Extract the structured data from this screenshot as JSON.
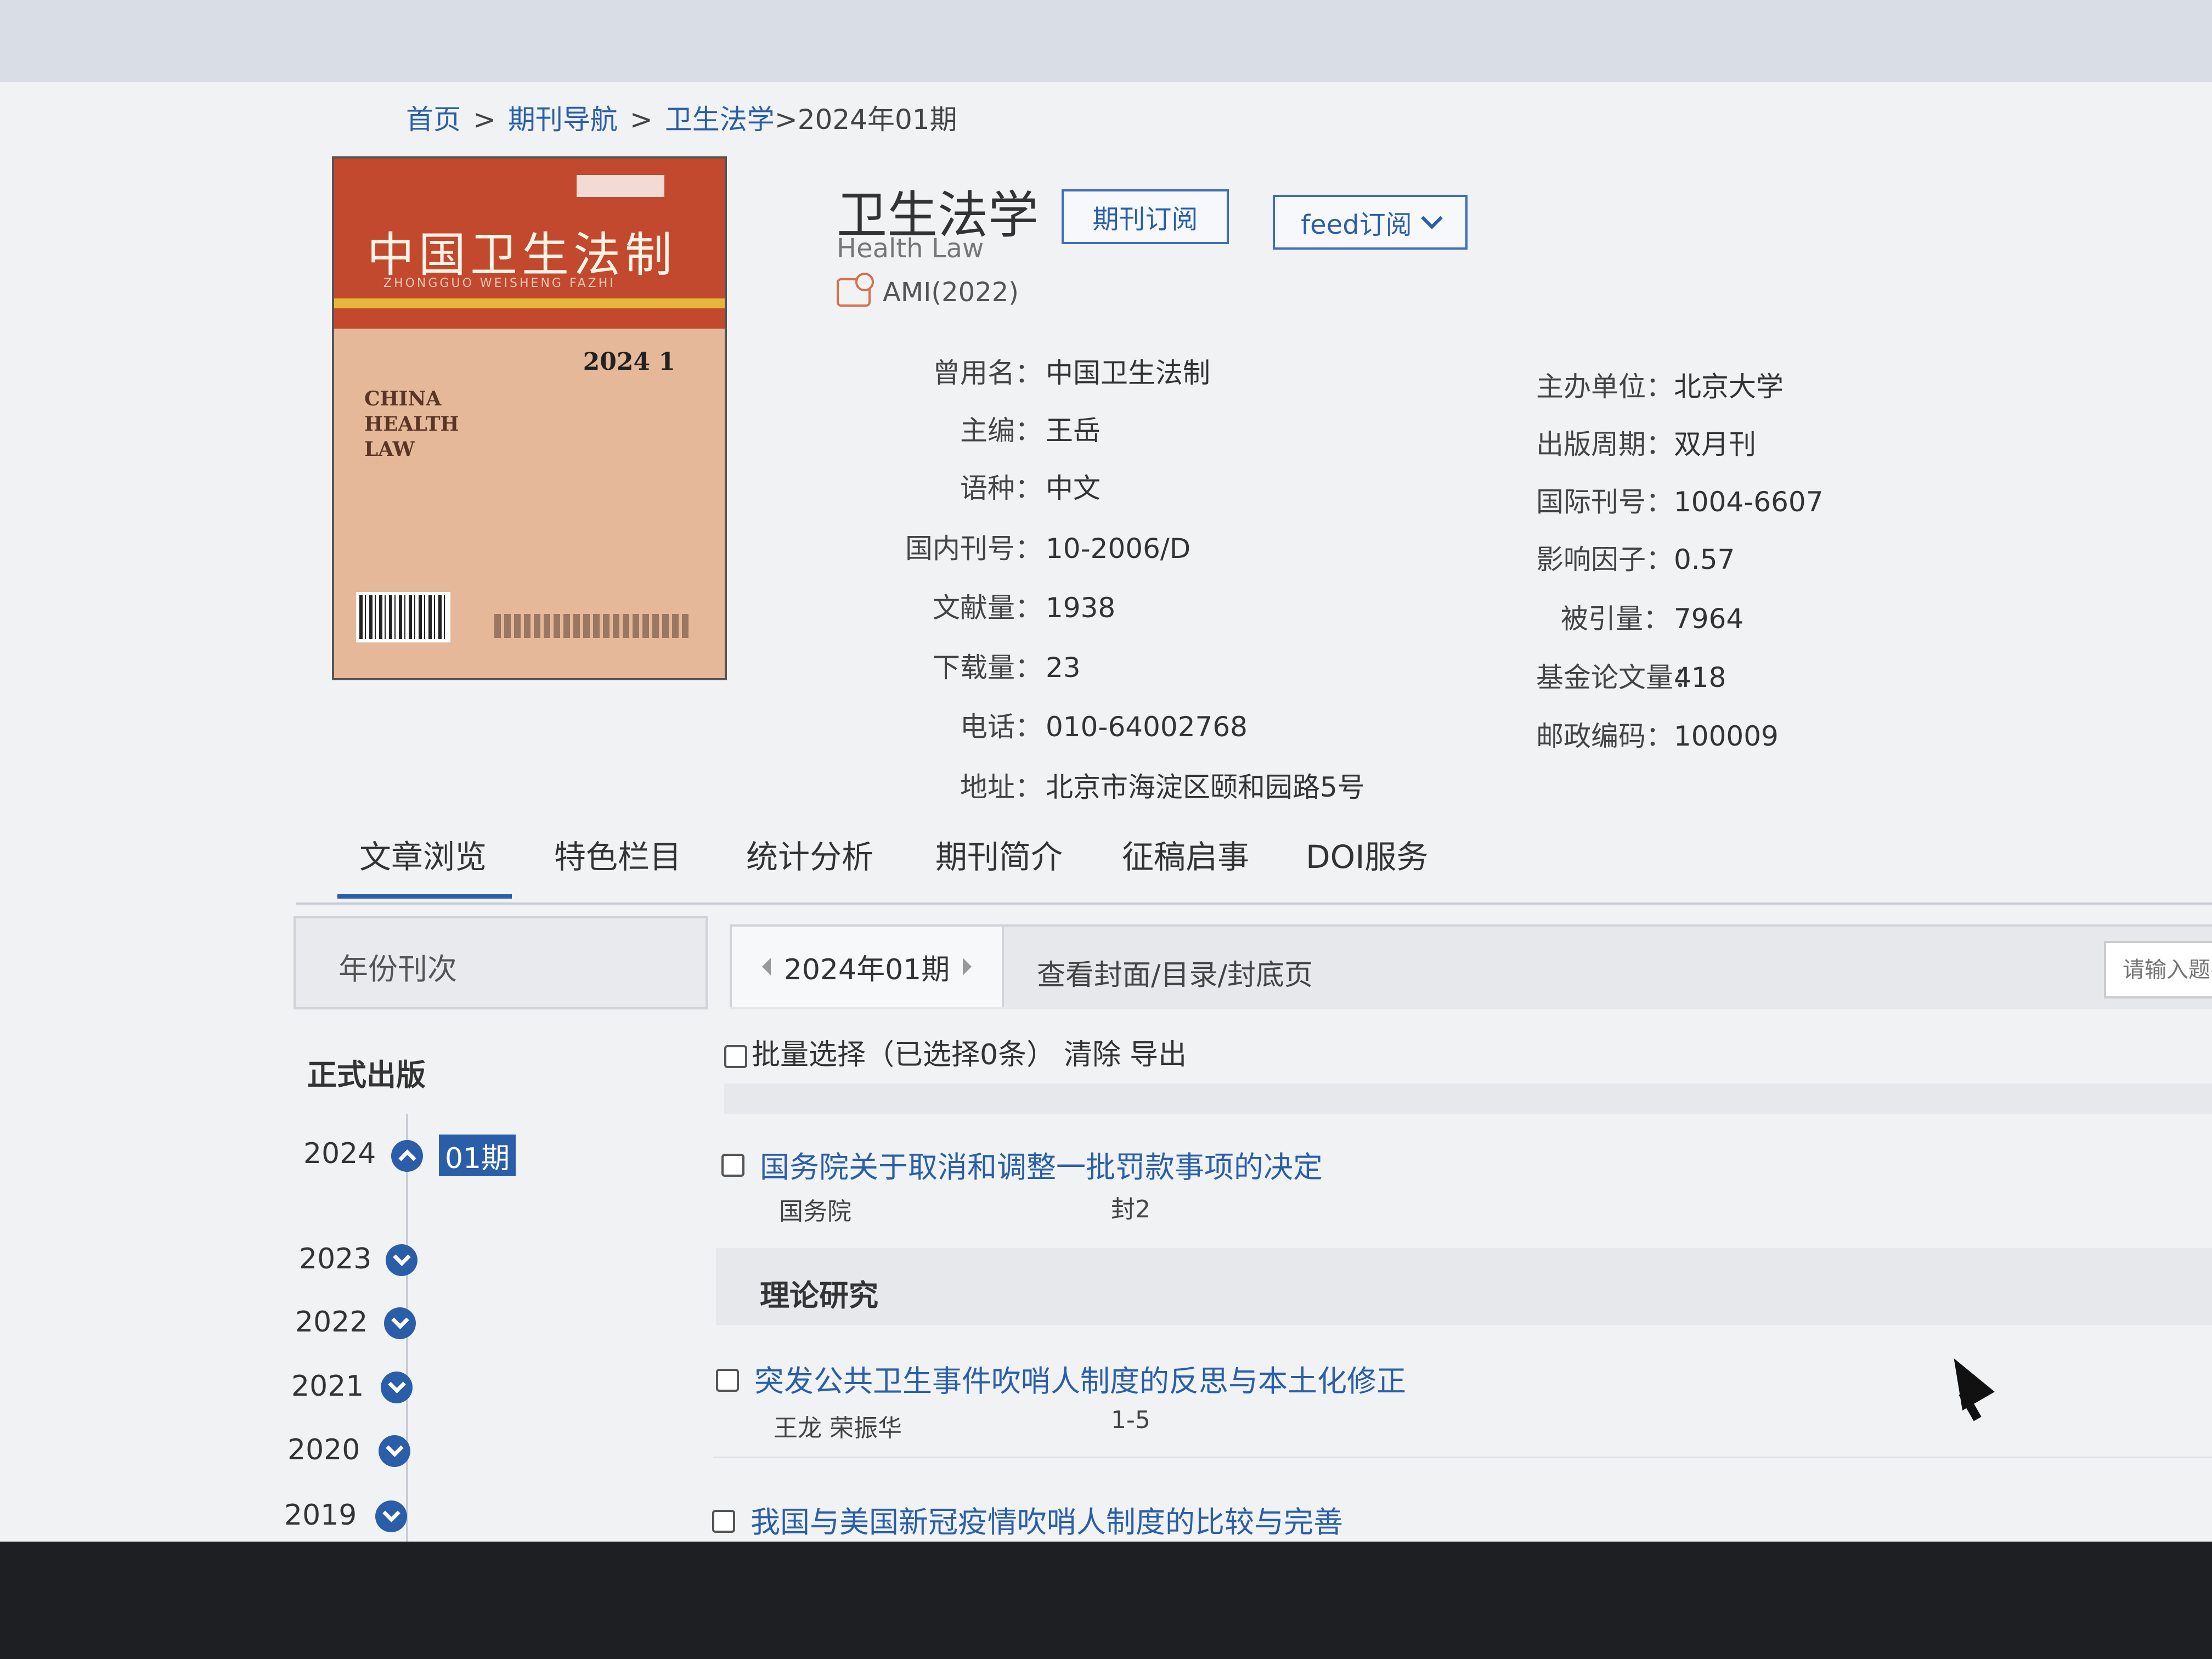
{
  "breadcrumb": {
    "home": "首页",
    "separator": ">",
    "journal_nav": "期刊导航",
    "journal": "卫生法学",
    "current": ">2024年01期"
  },
  "cover": {
    "title_cn": "中国卫生法制",
    "pinyin": "ZHONGGUO WEISHENG FAZHI",
    "issue": "2024 1",
    "title_en": [
      "CHINA",
      "HEALTH",
      "LAW"
    ]
  },
  "journal": {
    "title": "卫生法学",
    "title_en": "Health Law",
    "ami": "AMI(2022)",
    "subscribe_label": "期刊订阅",
    "feed_label": "feed订阅"
  },
  "info_left": [
    {
      "label": "曾用名：",
      "value": "中国卫生法制"
    },
    {
      "label": "主编：",
      "value": "王岳"
    },
    {
      "label": "语种：",
      "value": "中文"
    },
    {
      "label": "国内刊号：",
      "value": "10-2006/D"
    },
    {
      "label": "文献量：",
      "value": "1938"
    },
    {
      "label": "下载量：",
      "value": "23"
    },
    {
      "label": "电话：",
      "value": "010-64002768"
    },
    {
      "label": "地址：",
      "value": "北京市海淀区颐和园路5号"
    }
  ],
  "info_right": [
    {
      "label": "主办单位：",
      "value": "北京大学"
    },
    {
      "label": "出版周期：",
      "value": "双月刊"
    },
    {
      "label": "国际刊号：",
      "value": "1004-6607"
    },
    {
      "label": "影响因子：",
      "value": "0.57"
    },
    {
      "label": "被引量：",
      "value": "7964"
    },
    {
      "label": "基金论文量：",
      "value": "418"
    },
    {
      "label": "邮政编码：",
      "value": "100009"
    }
  ],
  "tabs": [
    "文章浏览",
    "特色栏目",
    "统计分析",
    "期刊简介",
    "征稿启事",
    "DOI服务"
  ],
  "left_panel": {
    "header": "年份刊次",
    "section": "正式出版",
    "years": [
      "2024",
      "2023",
      "2022",
      "2021",
      "2020",
      "2019"
    ],
    "selected_issue": "01期"
  },
  "right_panel": {
    "issue_label": "2024年01期",
    "view_cover": "查看封面/目录/封底页",
    "search_placeholder": "请输入题名",
    "batch_select": "批量选择（已选择0条）",
    "clear": "清除",
    "export": "导出"
  },
  "articles": [
    {
      "title": "国务院关于取消和调整一批罚款事项的决定",
      "author": "国务院",
      "page": "封2"
    },
    {
      "title": "突发公共卫生事件吹哨人制度的反思与本土化修正",
      "author": "王龙 荣振华",
      "page": "1-5"
    },
    {
      "title": "我国与美国新冠疫情吹哨人制度的比较与完善"
    }
  ],
  "column_section": "理论研究"
}
